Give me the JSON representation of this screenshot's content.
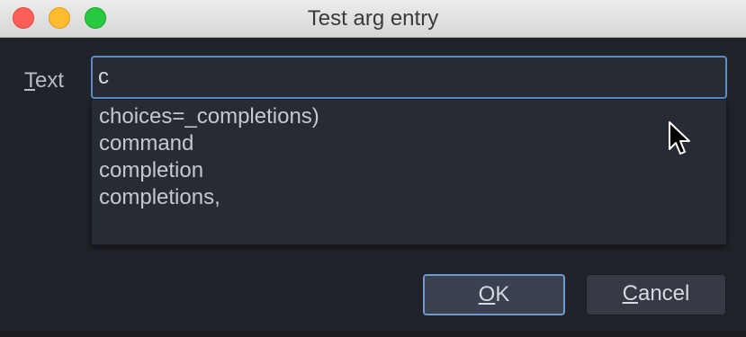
{
  "window": {
    "title": "Test arg entry"
  },
  "form": {
    "label_mnemonic": "T",
    "label_rest": "ext",
    "input_value": "c"
  },
  "completions": [
    {
      "label": "choices=_completions)"
    },
    {
      "label": "command"
    },
    {
      "label": "completion"
    },
    {
      "label": "completions,"
    }
  ],
  "buttons": {
    "ok_mnemonic": "O",
    "ok_rest": "K",
    "cancel_mnemonic": "C",
    "cancel_rest": "ancel"
  },
  "colors": {
    "accent_border": "#5b8ec9",
    "background": "#20232a",
    "titlebar": "#e3e3e3"
  },
  "icons": {
    "pointer": "arrow-cursor-icon"
  }
}
